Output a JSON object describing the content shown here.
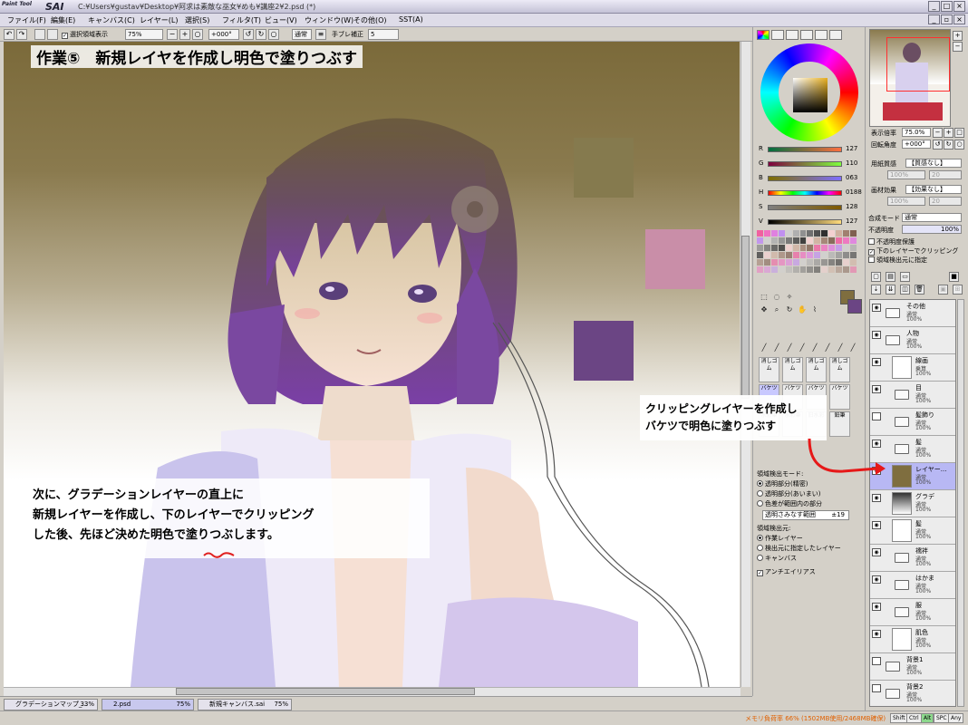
{
  "window": {
    "logo_small": "Paint Tool",
    "logo_big": "SAI",
    "title": "C:¥Users¥gustav¥Desktop¥阿求は素敵な巫女¥めも¥講座2¥2.psd (*)"
  },
  "menu": [
    "ファイル(F)",
    "編集(E)",
    "キャンバス(C)",
    "レイヤー(L)",
    "選択(S)",
    "フィルタ(T)",
    "ビュー(V)",
    "ウィンドウ(W)",
    "その他(O)",
    "SST(A)"
  ],
  "toolbar": {
    "selection_display": "選択領域表示",
    "zoom": "75%",
    "rotation": "+000°",
    "blend": "通常",
    "stabilizer_label": "手ブレ補正",
    "stabilizer_value": "5"
  },
  "canvas": {
    "heading": "作業⑤　新規レイヤを作成し明色で塗りつぶす",
    "instruction_lines": [
      "次に、グラデーションレイヤーの直上に",
      "新規レイヤーを作成し、下のレイヤーでクリッピング",
      "した後、先ほど決めた明色で塗りつぶします。"
    ],
    "clip_note_lines": [
      "クリッピングレイヤーを作成し",
      "バケツで明色に塗りつぶす"
    ],
    "swatches": {
      "olive": "#857a4e",
      "pink": "#c98ea8",
      "purple": "#6b4584"
    }
  },
  "color_panel": {
    "sliders": [
      {
        "label": "R",
        "value": "127"
      },
      {
        "label": "G",
        "value": "110"
      },
      {
        "label": "B",
        "value": "063"
      },
      {
        "label": "H",
        "value": "0188"
      },
      {
        "label": "S",
        "value": "128"
      },
      {
        "label": "V",
        "value": "127"
      }
    ],
    "current_color": "#7f6e3f",
    "brush_rows": [
      [
        "消しゴム",
        "消しゴム",
        "消しゴム",
        "消しゴム"
      ],
      [
        "バケツ",
        "バケツ",
        "バケツ",
        "バケツ"
      ],
      [
        "水彩筆",
        "水彩筆",
        "旧水彩",
        "鉛筆"
      ]
    ],
    "fill_options": {
      "mode_label": "領域検出モード:",
      "modes": [
        "透明部分(精密)",
        "透明部分(あいまい)",
        "色差が範囲内の部分"
      ],
      "range_label": "透明さみなす範囲",
      "range_value": "±19",
      "source_label": "領域検出元:",
      "sources": [
        "作業レイヤー",
        "検出元に指定したレイヤー",
        "キャンバス"
      ],
      "antialias": "アンチエイリアス"
    }
  },
  "right_panel": {
    "zoom_label": "表示倍率",
    "zoom_value": "75.0%",
    "rotate_label": "回転角度",
    "rotate_value": "+000°",
    "paper_label": "用紙質感",
    "paper_value": "【質感なし】",
    "paper_num1": "100%",
    "paper_num2": "20",
    "effect_label": "画材効果",
    "effect_value": "【効果なし】",
    "effect_num1": "100%",
    "effect_num2": "20",
    "blend_label": "合成モード",
    "blend_value": "通常",
    "opacity_label": "不透明度",
    "opacity_value": "100%",
    "checks": [
      "不透明度保護",
      "下のレイヤーでクリッピング",
      "領域検出元に指定"
    ],
    "layers": [
      {
        "name": "その他",
        "mode": "通常",
        "opacity": "100%",
        "type": "folder"
      },
      {
        "name": "人物",
        "mode": "通常",
        "opacity": "100%",
        "type": "folder"
      },
      {
        "name": "線画",
        "mode": "乗算",
        "opacity": "100%",
        "type": "layer"
      },
      {
        "name": "目",
        "mode": "通常",
        "opacity": "100%",
        "type": "folder"
      },
      {
        "name": "髪飾り",
        "mode": "通常",
        "opacity": "100%",
        "type": "folder"
      },
      {
        "name": "髪",
        "mode": "通常",
        "opacity": "100%",
        "type": "folder"
      },
      {
        "name": "レイヤー...",
        "mode": "通常",
        "opacity": "100%",
        "type": "fill",
        "selected": true
      },
      {
        "name": "グラデ",
        "mode": "通常",
        "opacity": "100%",
        "type": "gradient"
      },
      {
        "name": "髪",
        "mode": "通常",
        "opacity": "100%",
        "type": "layer"
      },
      {
        "name": "襦袢",
        "mode": "通常",
        "opacity": "100%",
        "type": "folder"
      },
      {
        "name": "はかま",
        "mode": "通常",
        "opacity": "100%",
        "type": "folder"
      },
      {
        "name": "服",
        "mode": "通常",
        "opacity": "100%",
        "type": "folder"
      },
      {
        "name": "肌色",
        "mode": "通常",
        "opacity": "100%",
        "type": "layer"
      },
      {
        "name": "背景1",
        "mode": "通常",
        "opacity": "100%",
        "type": "folder"
      },
      {
        "name": "背景2",
        "mode": "通常",
        "opacity": "100%",
        "type": "folder"
      }
    ]
  },
  "tasks": [
    {
      "name": "グラデーションマップ_...",
      "pct": "33%"
    },
    {
      "name": "2.psd",
      "pct": "75%"
    },
    {
      "name": "新規キャンバス.sai",
      "pct": "75%"
    }
  ],
  "status": {
    "memory": "メモリ負荷率 66% (1502MB使用/2468MB確保)",
    "keys": [
      "Shift",
      "Ctrl",
      "Alt",
      "SPC",
      "Any"
    ]
  }
}
